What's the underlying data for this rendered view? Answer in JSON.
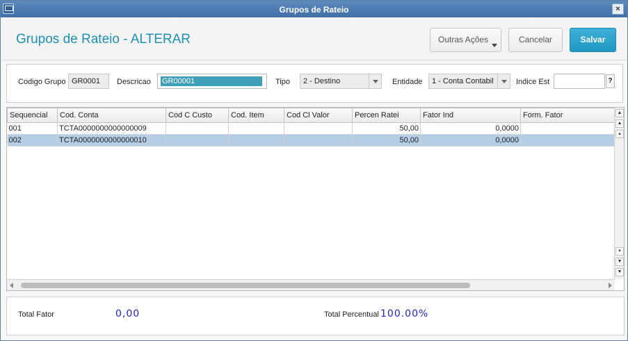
{
  "window": {
    "title": "Grupos de Rateio",
    "close_label": "×"
  },
  "header": {
    "title": "Grupos de Rateio - ALTERAR",
    "outras_acoes_label": "Outras Ações",
    "cancelar_label": "Cancelar",
    "salvar_label": "Salvar"
  },
  "form": {
    "codigo_grupo_label": "Codigo Grupo",
    "codigo_grupo_value": "GR0001",
    "descricao_label": "Descricao",
    "descricao_value": "GR00001",
    "tipo_label": "Tipo",
    "tipo_value": "2 - Destino",
    "entidade_label": "Entidade",
    "entidade_value": "1 - Conta Contabil",
    "indice_est_label": "Indice Est",
    "indice_est_value": "",
    "help_label": "?"
  },
  "grid": {
    "columns": [
      "Sequencial",
      "Cod. Conta",
      "Cod C Custo",
      "Cod. Item",
      "Cod Cl Valor",
      "Percen Ratei",
      "Fator Ind",
      "Form. Fator"
    ],
    "rows": [
      [
        "001",
        "TCTA0000000000000009",
        "",
        "",
        "",
        "50,00",
        "0,0000",
        ""
      ],
      [
        "002",
        "TCTA0000000000000010",
        "",
        "",
        "",
        "50,00",
        "0,0000",
        ""
      ]
    ],
    "selected_row": 1
  },
  "footer": {
    "total_fator_label": "Total Fator",
    "total_fator_value": "0,00",
    "total_percentual_label": "Total Percentual",
    "total_percentual_value": "100.00%"
  },
  "colors": {
    "accent": "#1d8fb3",
    "primary_button": "#25a2cc",
    "selection": "#b6cde6",
    "totals": "#2222cc"
  }
}
